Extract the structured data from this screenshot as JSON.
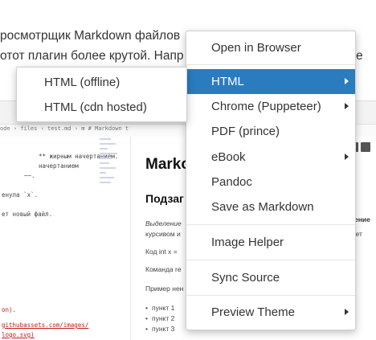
{
  "background": {
    "line1": "росмотрщик Markdown файлов",
    "line2": "отот плагин более крутой. Напр",
    "line2_tail": "е"
  },
  "screenshot": {
    "breadcrumb": "ode › files › test.md › ⊞ # Markdown test",
    "code_lines": [
      "** жирным начертанием.",
      "начертанием",
      "~~.",
      "енула `x`.",
      "ет новый файл.",
      "on).",
      "githubassets.com/images/",
      "logo.svg)"
    ],
    "preview": {
      "h1": "Marko",
      "h2": "Подзаг",
      "p1": "Выделение",
      "p2": "курсивом и",
      "p3": "Код int x =",
      "p4": "Команда re",
      "p5": "Пример нен",
      "list": [
        "пункт 1",
        "пункт 2",
        "пункт 3"
      ],
      "right1": "еление",
      "right2": "шает"
    }
  },
  "main_menu": {
    "items": [
      {
        "label": "Open in Browser",
        "submenu": false
      },
      {
        "label": "HTML",
        "submenu": true,
        "active": true
      },
      {
        "label": "Chrome (Puppeteer)",
        "submenu": true
      },
      {
        "label": "PDF (prince)",
        "submenu": false
      },
      {
        "label": "eBook",
        "submenu": true
      },
      {
        "label": "Pandoc",
        "submenu": false
      },
      {
        "label": "Save as Markdown",
        "submenu": false
      },
      {
        "label": "Image Helper",
        "submenu": false
      },
      {
        "label": "Sync Source",
        "submenu": false
      },
      {
        "label": "Preview Theme",
        "submenu": true
      }
    ]
  },
  "html_submenu": {
    "items": [
      {
        "label": "HTML (offline)"
      },
      {
        "label": "HTML (cdn hosted)"
      }
    ]
  },
  "colors": {
    "menu_highlight": "#2b7bbf",
    "menu_text": "#333333"
  }
}
